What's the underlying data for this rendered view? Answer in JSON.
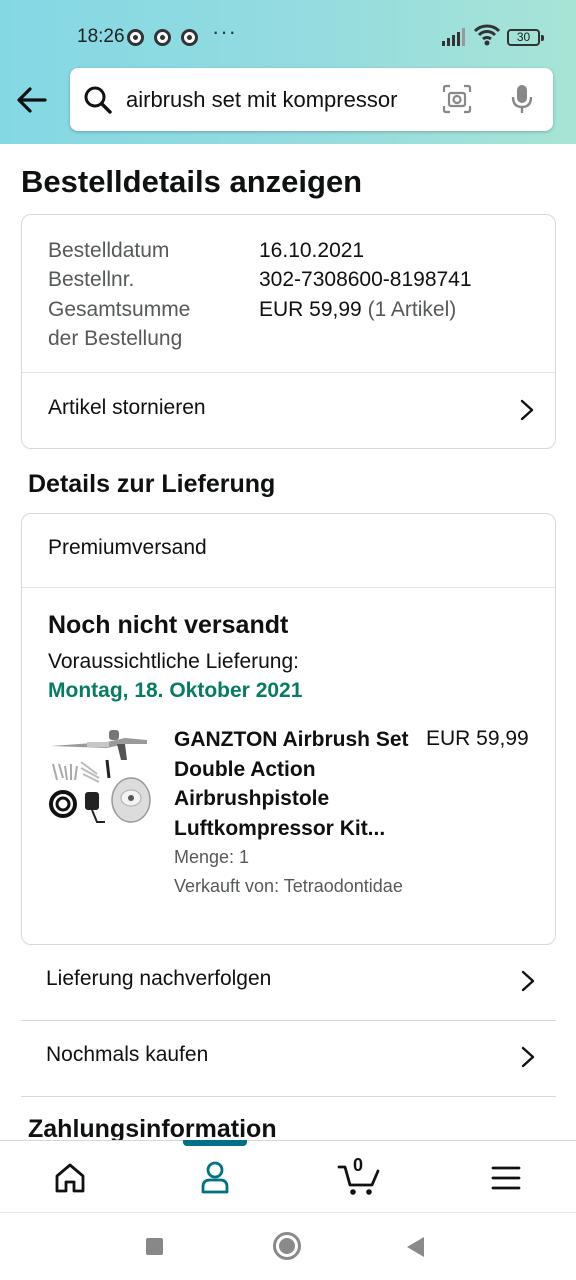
{
  "status_bar": {
    "time": "18:26",
    "more": "···",
    "battery": "30"
  },
  "search": {
    "query": "airbrush set mit kompressor"
  },
  "page_title": "Bestelldetails anzeigen",
  "order": {
    "date_label": "Bestelldatum",
    "date_value": "16.10.2021",
    "number_label": "Bestellnr.",
    "number_value": "302-7308600-8198741",
    "total_label_1": "Gesamtsumme",
    "total_label_2": "der Bestellung",
    "total_value": "EUR 59,99",
    "total_items": "(1 Artikel)",
    "cancel_label": "Artikel stornieren"
  },
  "delivery": {
    "section_title": "Details zur Lieferung",
    "shipping_method": "Premiumversand",
    "status": "Noch nicht versandt",
    "estimate_label": "Voraussichtliche Lieferung:",
    "estimate_date": "Montag, 18. Oktober 2021",
    "product": {
      "title": "GANZTON Airbrush Set Double Action Airbrushpistole Luftkompressor Kit...",
      "price": "EUR 59,99",
      "quantity": "Menge: 1",
      "seller": "Verkauft von: Tetraodontidae"
    }
  },
  "actions": {
    "track": "Lieferung nachverfolgen",
    "buy_again": "Nochmals kaufen"
  },
  "payment_title": "Zahlungsinformation",
  "bottom_nav": {
    "cart_count": "0",
    "active": "account"
  },
  "colors": {
    "accent": "#007185",
    "delivery_green": "#067d62",
    "header_gradient_start": "#84d8e4",
    "header_gradient_end": "#a7e4d6"
  }
}
